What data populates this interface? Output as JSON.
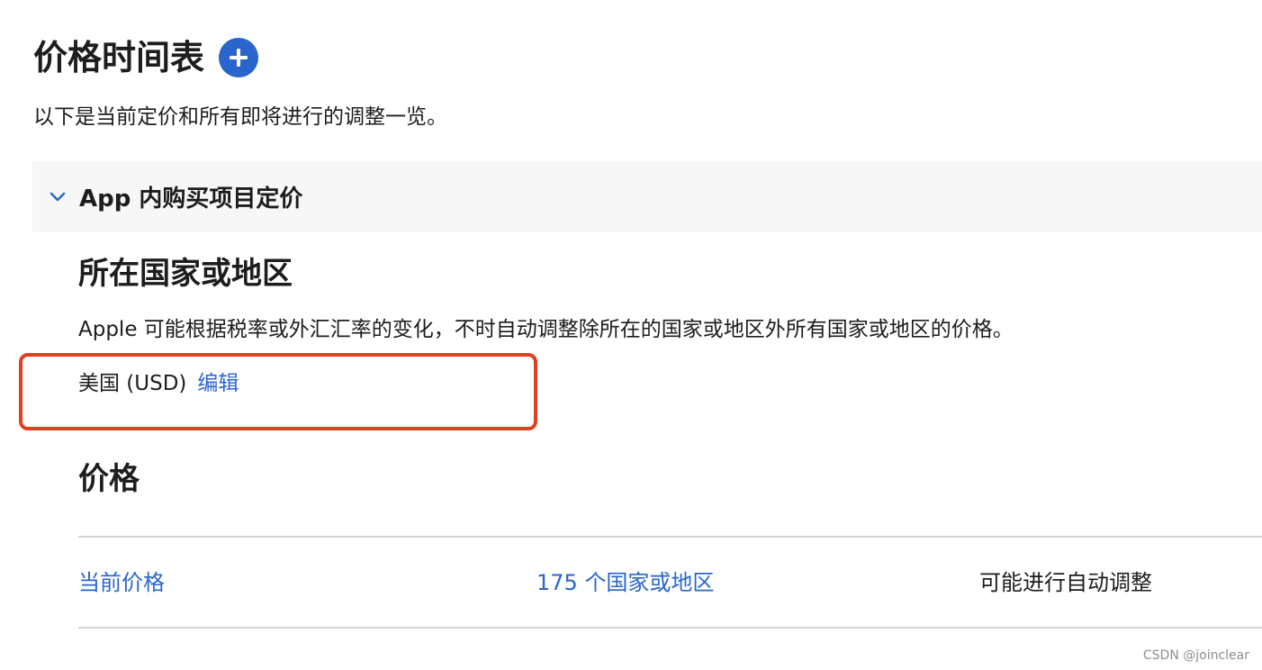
{
  "header": {
    "title": "价格时间表",
    "subtitle": "以下是当前定价和所有即将进行的调整一览。"
  },
  "section": {
    "title": "App 内购买项目定价"
  },
  "country": {
    "heading": "所在国家或地区",
    "description": "Apple 可能根据税率或外汇汇率的变化，不时自动调整除所在的国家或地区外所有国家或地区的价格。",
    "value": "美国 (USD)",
    "edit_label": "编辑"
  },
  "price": {
    "heading": "价格",
    "row": {
      "current_label": "当前价格",
      "countries_label": "175 个国家或地区",
      "adjust_label": "可能进行自动调整"
    }
  },
  "watermark": "CSDN @joinclear",
  "colors": {
    "accent": "#2a65cc",
    "highlight": "#e0401f"
  }
}
